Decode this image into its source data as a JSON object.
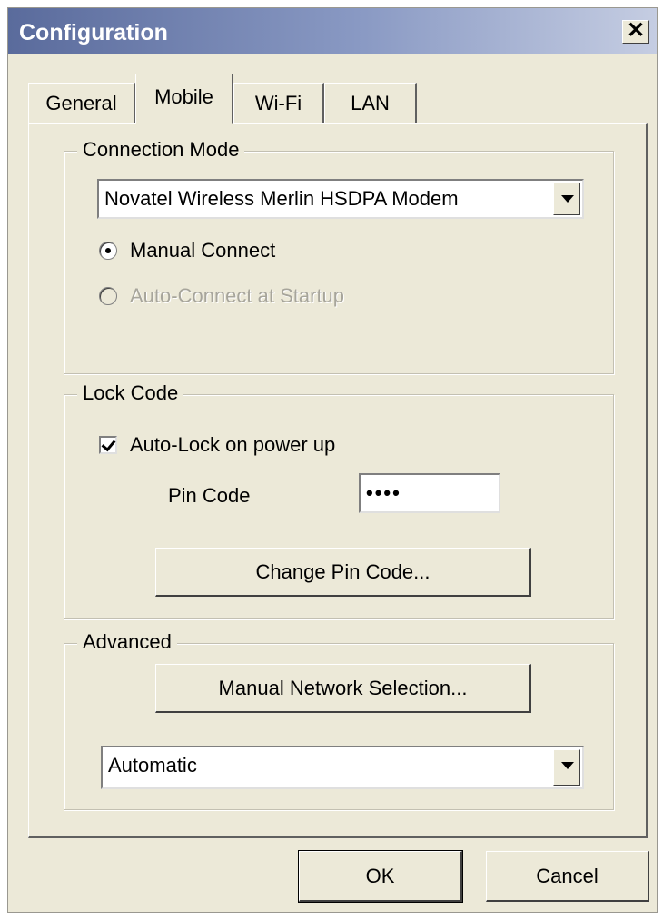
{
  "window": {
    "title": "Configuration",
    "close_glyph": "✕"
  },
  "tabs": [
    {
      "label": "General"
    },
    {
      "label": "Mobile",
      "active": true
    },
    {
      "label": "Wi-Fi"
    },
    {
      "label": "LAN"
    }
  ],
  "connection_mode": {
    "legend": "Connection Mode",
    "device_select": "Novatel Wireless Merlin HSDPA Modem",
    "manual_connect": {
      "label": "Manual Connect",
      "selected": true
    },
    "auto_connect": {
      "label": "Auto-Connect at Startup",
      "selected": false,
      "disabled": true
    }
  },
  "lock_code": {
    "legend": "Lock Code",
    "auto_lock": {
      "label": "Auto-Lock on power up",
      "checked": true
    },
    "pin_label": "Pin Code",
    "pin_value": "••••",
    "change_pin_button": "Change Pin Code..."
  },
  "advanced": {
    "legend": "Advanced",
    "manual_network_button": "Manual Network Selection...",
    "network_select": "Automatic"
  },
  "footer": {
    "ok": "OK",
    "cancel": "Cancel"
  },
  "icons": {
    "dropdown": "chevron-down-icon",
    "close": "close-icon"
  }
}
